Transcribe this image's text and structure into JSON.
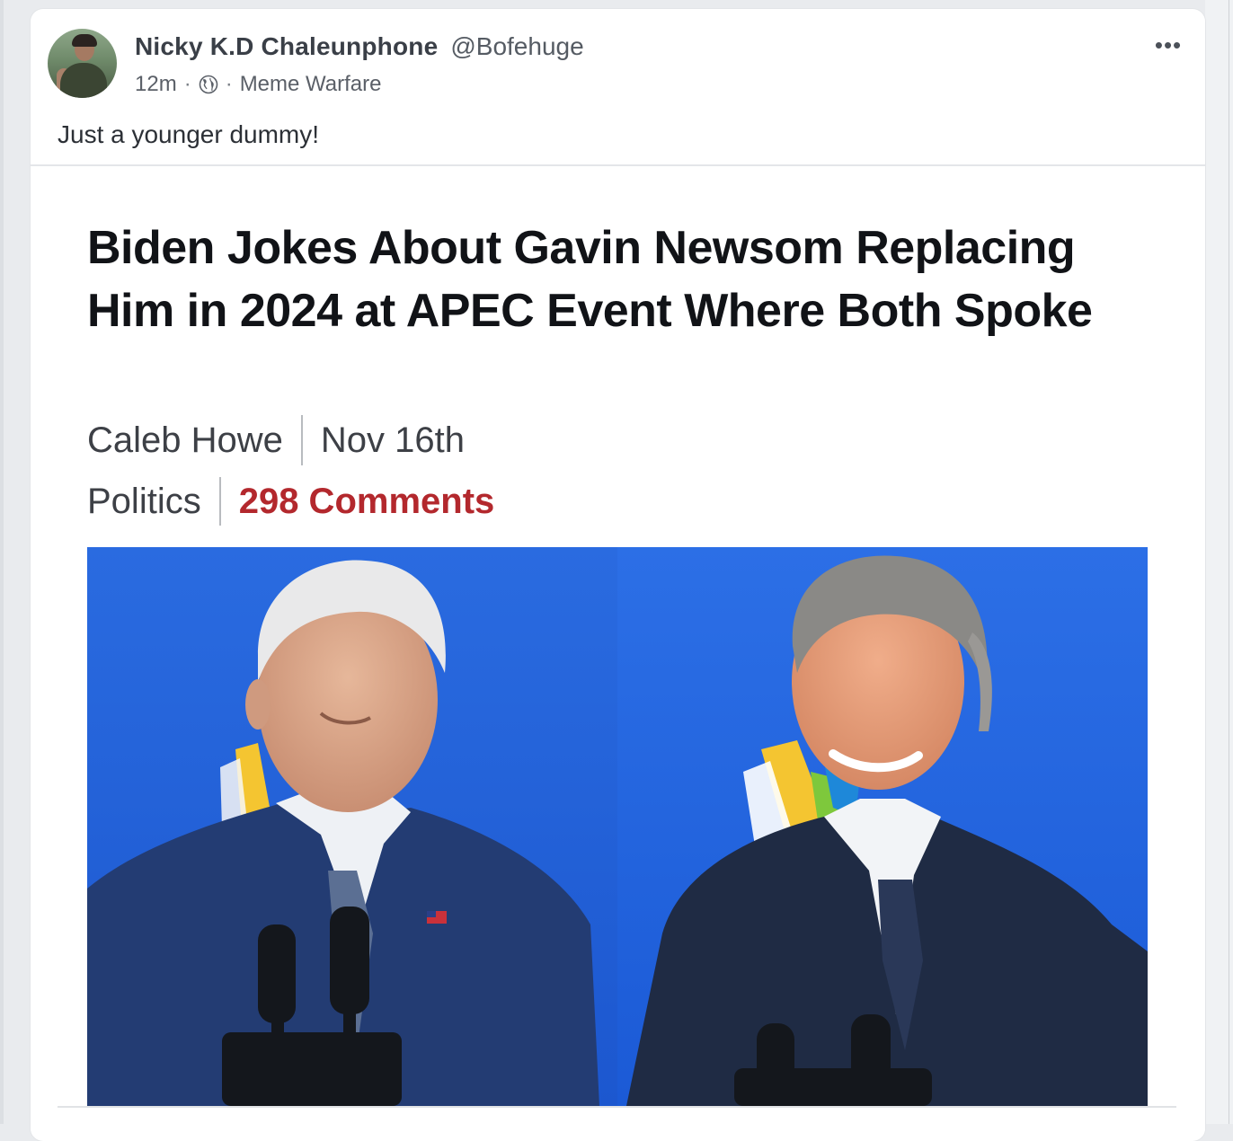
{
  "post": {
    "author_name": "Nicky K.D Chaleunphone",
    "author_handle": "@Bofehuge",
    "time_ago": "12m",
    "separator": "·",
    "audience_icon": "globe-icon",
    "group_name": "Meme Warfare",
    "more_icon": "more-horizontal-icon",
    "more_label": "•••",
    "text": "Just a younger dummy!"
  },
  "article": {
    "headline": "Biden Jokes About Gavin Newsom Replacing Him in 2024 at APEC Event Where Both Spoke",
    "author": "Caleb Howe",
    "date": "Nov 16th",
    "category": "Politics",
    "comments": "298 Comments",
    "photo_description_icon": "news-photo"
  },
  "colors": {
    "accent_comments": "#b3282d",
    "photo_background": "#1f5fd4",
    "card_background": "#ffffff",
    "page_background": "#e9ebee"
  }
}
